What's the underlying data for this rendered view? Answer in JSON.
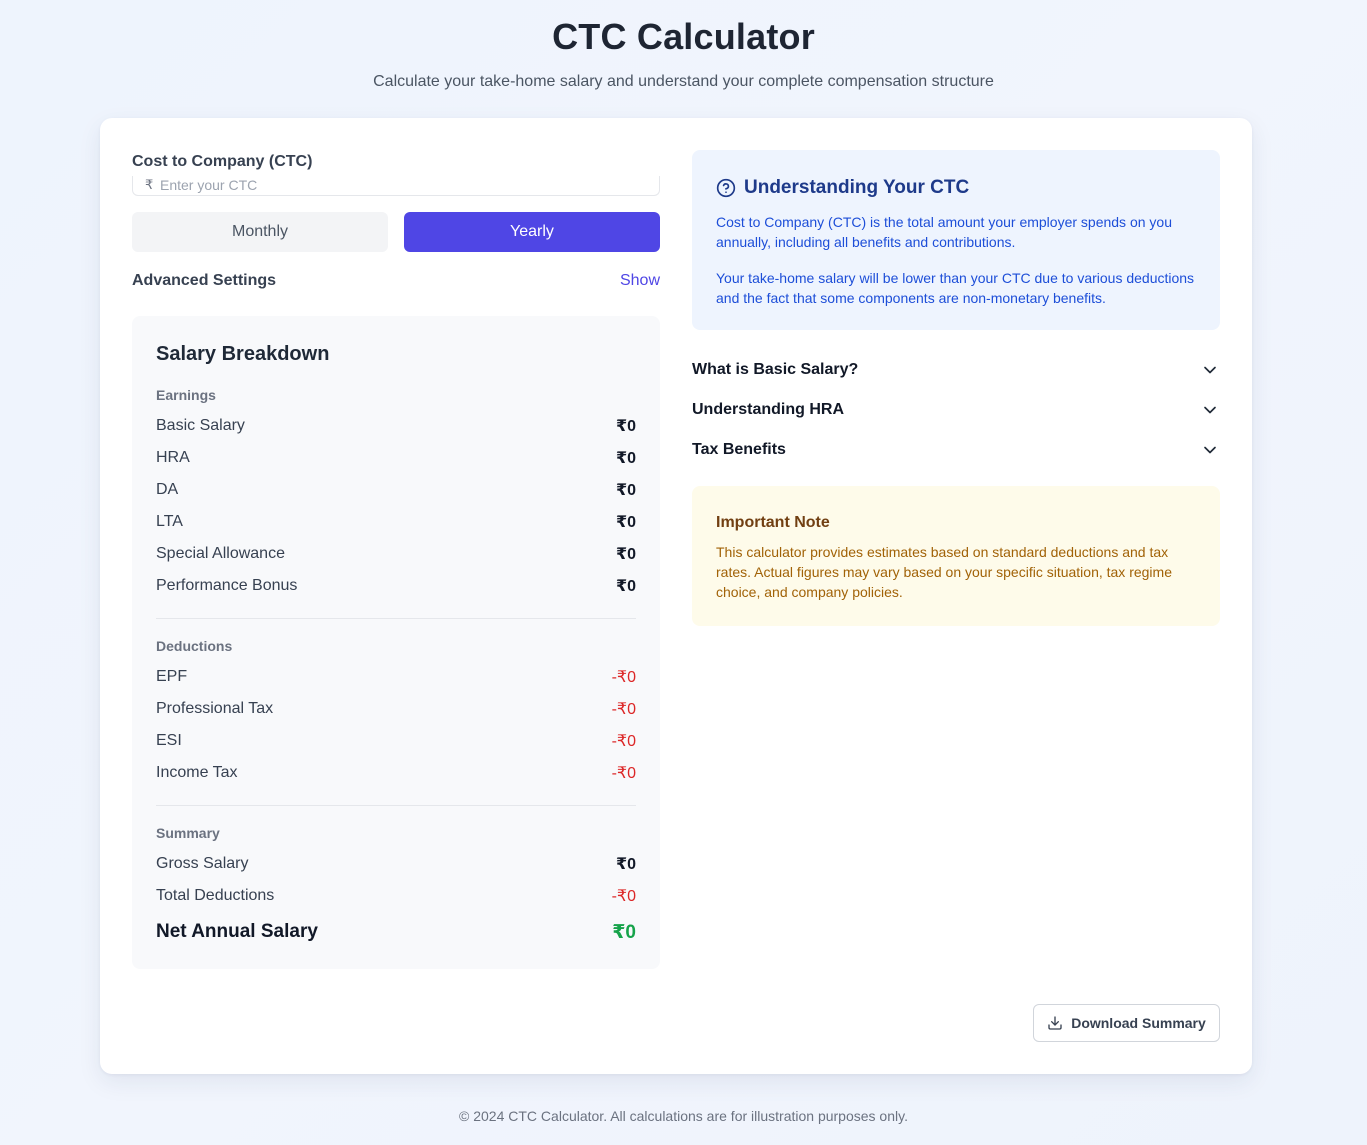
{
  "header": {
    "title": "CTC Calculator",
    "subtitle": "Calculate your take-home salary and understand your complete compensation structure"
  },
  "ctc_input": {
    "label": "Cost to Company (CTC)",
    "currency_symbol": "₹",
    "placeholder": "Enter your CTC",
    "value": ""
  },
  "period_toggle": {
    "monthly_label": "Monthly",
    "yearly_label": "Yearly",
    "selected": "Yearly"
  },
  "advanced_settings": {
    "label": "Advanced Settings",
    "toggle_label": "Show"
  },
  "breakdown": {
    "title": "Salary Breakdown",
    "earnings": {
      "title": "Earnings",
      "items": [
        {
          "name": "Basic Salary",
          "value": "₹0"
        },
        {
          "name": "HRA",
          "value": "₹0"
        },
        {
          "name": "DA",
          "value": "₹0"
        },
        {
          "name": "LTA",
          "value": "₹0"
        },
        {
          "name": "Special Allowance",
          "value": "₹0"
        },
        {
          "name": "Performance Bonus",
          "value": "₹0"
        }
      ]
    },
    "deductions": {
      "title": "Deductions",
      "items": [
        {
          "name": "EPF",
          "value": "-₹0"
        },
        {
          "name": "Professional Tax",
          "value": "-₹0"
        },
        {
          "name": "ESI",
          "value": "-₹0"
        },
        {
          "name": "Income Tax",
          "value": "-₹0"
        }
      ]
    },
    "summary": {
      "title": "Summary",
      "gross_label": "Gross Salary",
      "gross_value": "₹0",
      "total_deductions_label": "Total Deductions",
      "total_deductions_value": "-₹0",
      "net_label": "Net Annual Salary",
      "net_value": "₹0"
    }
  },
  "info": {
    "title": "Understanding Your CTC",
    "paragraph1": "Cost to Company (CTC) is the total amount your employer spends on you annually, including all benefits and contributions.",
    "paragraph2": "Your take-home salary will be lower than your CTC due to various deductions and the fact that some components are non-monetary benefits."
  },
  "faq": [
    {
      "question": "What is Basic Salary?"
    },
    {
      "question": "Understanding HRA"
    },
    {
      "question": "Tax Benefits"
    }
  ],
  "note": {
    "title": "Important Note",
    "text": "This calculator provides estimates based on standard deductions and tax rates. Actual figures may vary based on your specific situation, tax regime choice, and company policies."
  },
  "download_label": "Download Summary",
  "footer": "© 2024 CTC Calculator. All calculations are for illustration purposes only.",
  "colors": {
    "accent": "#4f46e5",
    "negative": "#dc2626",
    "positive": "#16a34a",
    "info_bg": "#eef4fe",
    "note_bg": "#fefbea"
  }
}
